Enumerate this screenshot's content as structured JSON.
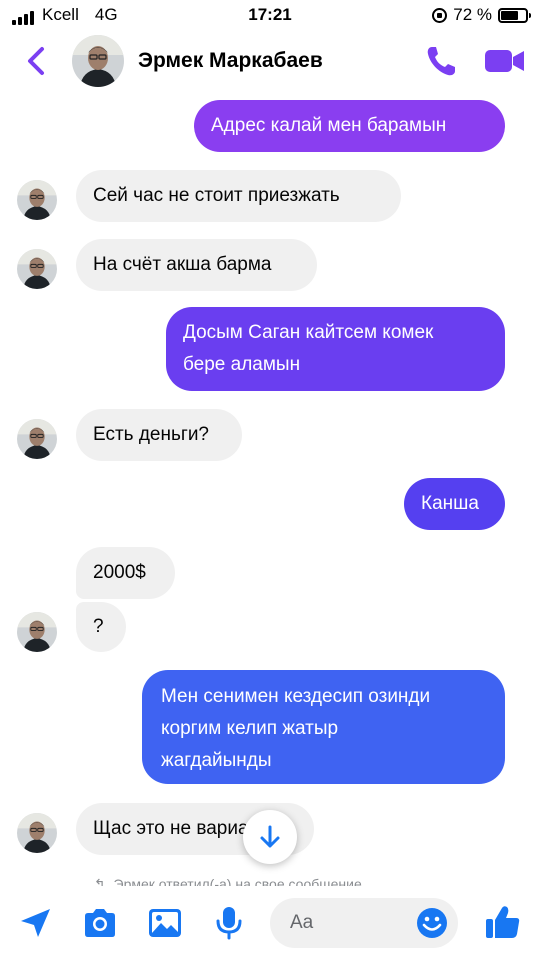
{
  "status_bar": {
    "carrier": "Kcell",
    "network": "4G",
    "time": "17:21",
    "battery": "72 %",
    "battery_level": 0.72
  },
  "header": {
    "contact_name": "Эрмек Маркабаев"
  },
  "messages": [
    {
      "direction": "outgoing",
      "text": "Адрес калай мен барамын"
    },
    {
      "direction": "incoming",
      "text": "Сей час не стоит приезжать"
    },
    {
      "direction": "incoming",
      "text": "На счёт акша барма"
    },
    {
      "direction": "outgoing",
      "lines": [
        "Досым Саган кайтсем комек",
        "бере аламын"
      ]
    },
    {
      "direction": "incoming",
      "text": "Есть деньги?"
    },
    {
      "direction": "outgoing",
      "text": "Канша"
    },
    {
      "direction": "incoming",
      "text": "2000$"
    },
    {
      "direction": "incoming",
      "text": "?"
    },
    {
      "direction": "outgoing",
      "lines": [
        "Мен сенимен кездесип озинди",
        "коргим келип жатыр",
        "жагдайынды"
      ]
    },
    {
      "direction": "incoming",
      "text": "Щас это не вариант"
    }
  ],
  "reply_note": "Эрмек ответил(-а) на свое сообщение",
  "composer": {
    "placeholder": "Aa"
  },
  "colors": {
    "accent": "#7b3ff2",
    "outgoing_top": "#8b3ef0",
    "outgoing_mid": "#5d3ef0",
    "outgoing_bottom": "#3f6ef2",
    "incoming_bg": "#f0f0f0",
    "icon_blue": "#1877f2"
  }
}
